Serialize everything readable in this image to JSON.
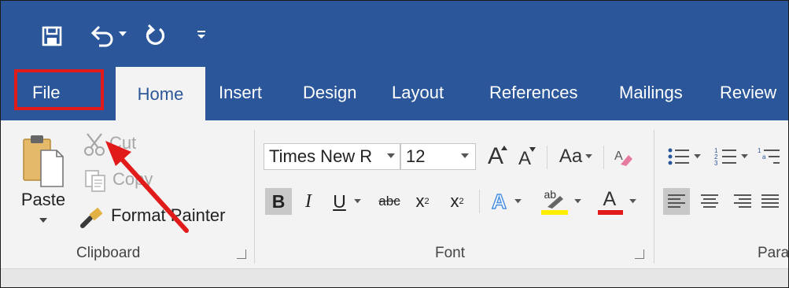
{
  "quick_access": {
    "save_icon": "save-icon",
    "undo_icon": "undo-icon",
    "undo_dropdown_icon": "chevron-down-icon",
    "redo_icon": "repeat-icon",
    "customize_icon": "customize-qat-icon"
  },
  "tabs": [
    {
      "label": "File",
      "active": false
    },
    {
      "label": "Home",
      "active": true
    },
    {
      "label": "Insert",
      "active": false
    },
    {
      "label": "Design",
      "active": false
    },
    {
      "label": "Layout",
      "active": false
    },
    {
      "label": "References",
      "active": false
    },
    {
      "label": "Mailings",
      "active": false
    },
    {
      "label": "Review",
      "active": false
    }
  ],
  "clipboard": {
    "paste_label": "Paste",
    "cut_label": "Cut",
    "copy_label": "Copy",
    "format_painter_label": "Format Painter",
    "group_label": "Clipboard"
  },
  "font": {
    "font_name": "Times New R",
    "font_size": "12",
    "grow_font": "A",
    "shrink_font": "A",
    "change_case": "Aa",
    "bold": "B",
    "italic": "I",
    "underline": "U",
    "strikethrough": "abc",
    "subscript": "x",
    "subscript_mark": "2",
    "superscript": "x",
    "superscript_mark": "2",
    "text_effects": "A",
    "highlight": "ab",
    "font_color": "A",
    "group_label": "Font"
  },
  "paragraph": {
    "group_label": "Para"
  },
  "colors": {
    "ribbon_blue": "#2b579a",
    "highlight_yellow": "#ffee00",
    "font_color_red": "#e11a1a",
    "annotation_red": "#e11a1a"
  }
}
